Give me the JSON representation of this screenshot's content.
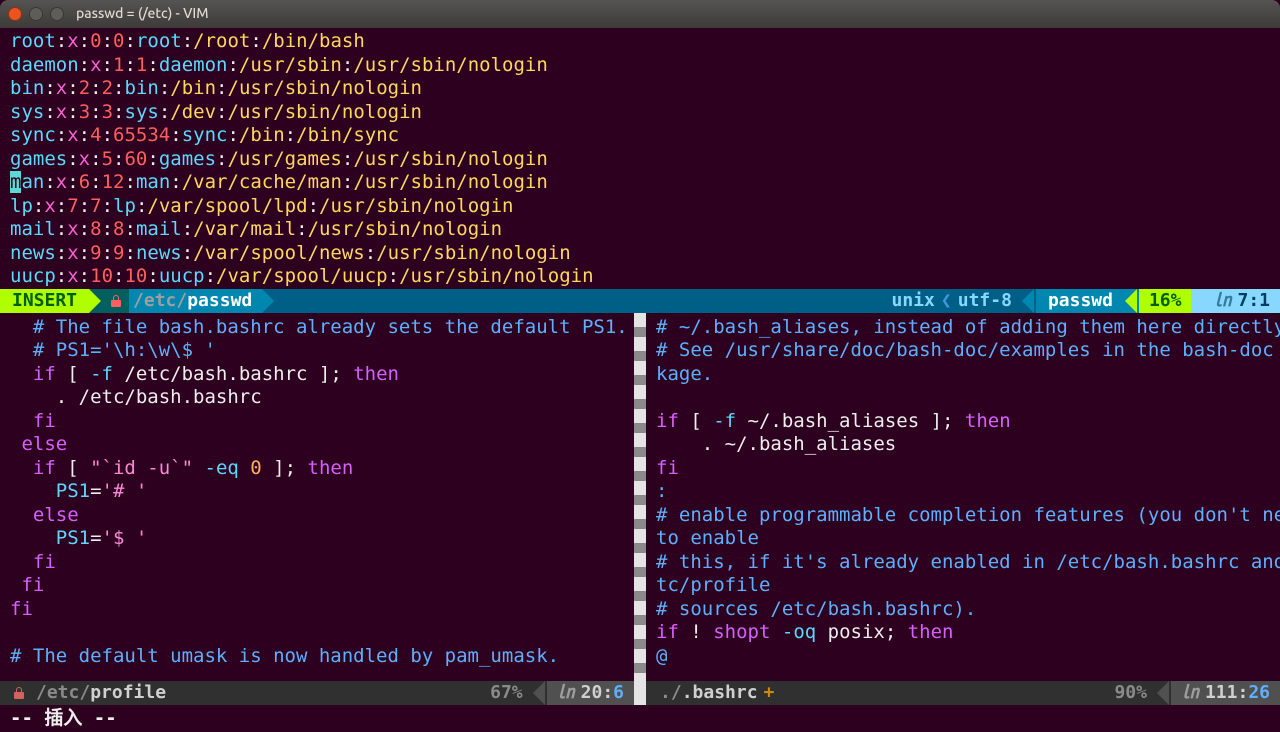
{
  "window": {
    "title": "passwd = (/etc) - VIM"
  },
  "top_status": {
    "mode": "INSERT",
    "path_dir": "/etc/",
    "path_file": "passwd",
    "encoding_left": "unix",
    "encoding_right": "utf-8",
    "filetype": "passwd",
    "percent": "16%",
    "ln_label": "㏑",
    "pos": "7:1"
  },
  "left_status": {
    "path_dir": "/etc/",
    "path_file": "profile",
    "percent": "67%",
    "ln_label": "㏑",
    "line": "20",
    "col": "6"
  },
  "right_status": {
    "path_dir": "./",
    "path_file": ".bashrc",
    "modified": "+",
    "percent": "90%",
    "ln_label": "㏑",
    "line": "111",
    "col": "26"
  },
  "cmdline": "-- 插入 --",
  "passwd": [
    {
      "user": "root",
      "x": "x",
      "uid": "0",
      "gid": "0",
      "gecos": "root",
      "home": "/root",
      "shell": "/bin/bash"
    },
    {
      "user": "daemon",
      "x": "x",
      "uid": "1",
      "gid": "1",
      "gecos": "daemon",
      "home": "/usr/sbin",
      "shell": "/usr/sbin/nologin"
    },
    {
      "user": "bin",
      "x": "x",
      "uid": "2",
      "gid": "2",
      "gecos": "bin",
      "home": "/bin",
      "shell": "/usr/sbin/nologin"
    },
    {
      "user": "sys",
      "x": "x",
      "uid": "3",
      "gid": "3",
      "gecos": "sys",
      "home": "/dev",
      "shell": "/usr/sbin/nologin"
    },
    {
      "user": "sync",
      "x": "x",
      "uid": "4",
      "gid": "65534",
      "gecos": "sync",
      "home": "/bin",
      "shell": "/bin/sync"
    },
    {
      "user": "games",
      "x": "x",
      "uid": "5",
      "gid": "60",
      "gecos": "games",
      "home": "/usr/games",
      "shell": "/usr/sbin/nologin"
    },
    {
      "user": "man",
      "x": "x",
      "uid": "6",
      "gid": "12",
      "gecos": "man",
      "home": "/var/cache/man",
      "shell": "/usr/sbin/nologin"
    },
    {
      "user": "lp",
      "x": "x",
      "uid": "7",
      "gid": "7",
      "gecos": "lp",
      "home": "/var/spool/lpd",
      "shell": "/usr/sbin/nologin"
    },
    {
      "user": "mail",
      "x": "x",
      "uid": "8",
      "gid": "8",
      "gecos": "mail",
      "home": "/var/mail",
      "shell": "/usr/sbin/nologin"
    },
    {
      "user": "news",
      "x": "x",
      "uid": "9",
      "gid": "9",
      "gecos": "news",
      "home": "/var/spool/news",
      "shell": "/usr/sbin/nologin"
    },
    {
      "user": "uucp",
      "x": "x",
      "uid": "10",
      "gid": "10",
      "gecos": "uucp",
      "home": "/var/spool/uucp",
      "shell": "/usr/sbin/nologin"
    }
  ],
  "profile_lines": [
    [
      [
        "c-comment",
        "  # The file bash.bashrc already sets the default PS1."
      ]
    ],
    [
      [
        "c-comment",
        "  # PS1='\\h:\\w\\$ '"
      ]
    ],
    [
      [
        "c-kw",
        "  if"
      ],
      [
        "c-plain",
        " [ "
      ],
      [
        "c-id",
        "-f"
      ],
      [
        "c-plain",
        " /etc/bash.bashrc ]; "
      ],
      [
        "c-kw",
        "then"
      ]
    ],
    [
      [
        "c-plain",
        "    . /etc/bash.bashrc"
      ]
    ],
    [
      [
        "c-kw",
        "  fi"
      ]
    ],
    [
      [
        "c-kw",
        " else"
      ]
    ],
    [
      [
        "c-kw",
        "  if"
      ],
      [
        "c-plain",
        " [ "
      ],
      [
        "c-str",
        "\"`id -u`\""
      ],
      [
        "c-plain",
        " "
      ],
      [
        "c-id",
        "-eq"
      ],
      [
        "c-plain",
        " "
      ],
      [
        "c-num",
        "0"
      ],
      [
        "c-plain",
        " ]; "
      ],
      [
        "c-kw",
        "then"
      ]
    ],
    [
      [
        "c-id",
        "    PS1"
      ],
      [
        "c-sym",
        "="
      ],
      [
        "c-str",
        "'# '"
      ]
    ],
    [
      [
        "c-kw",
        "  else"
      ]
    ],
    [
      [
        "c-id",
        "    PS1"
      ],
      [
        "c-sym",
        "="
      ],
      [
        "c-str",
        "'$ '"
      ]
    ],
    [
      [
        "c-kw",
        "  fi"
      ]
    ],
    [
      [
        "c-kw",
        " fi"
      ]
    ],
    [
      [
        "c-kw",
        "fi"
      ]
    ],
    [
      [
        "c-plain",
        ""
      ]
    ],
    [
      [
        "c-comment",
        "# The default umask is now handled by pam_umask."
      ]
    ]
  ],
  "bashrc_lines": [
    [
      [
        "c-comment",
        "# ~/.bash_aliases, instead of adding them here directly."
      ]
    ],
    [
      [
        "c-comment",
        "# See /usr/share/doc/bash-doc/examples in the bash-doc pac"
      ]
    ],
    [
      [
        "c-comment",
        "kage."
      ]
    ],
    [
      [
        "c-plain",
        ""
      ]
    ],
    [
      [
        "c-kw",
        "if"
      ],
      [
        "c-plain",
        " [ "
      ],
      [
        "c-id",
        "-f"
      ],
      [
        "c-plain",
        " ~/.bash_aliases ]; "
      ],
      [
        "c-kw",
        "then"
      ]
    ],
    [
      [
        "c-plain",
        "    . ~/.bash_aliases"
      ]
    ],
    [
      [
        "c-kw",
        "fi"
      ]
    ],
    [
      [
        "c-comment",
        ":"
      ]
    ],
    [
      [
        "c-comment",
        "# enable programmable completion features (you don't need "
      ]
    ],
    [
      [
        "c-comment",
        "to enable"
      ]
    ],
    [
      [
        "c-comment",
        "# this, if it's already enabled in /etc/bash.bashrc and /e"
      ]
    ],
    [
      [
        "c-comment",
        "tc/profile"
      ]
    ],
    [
      [
        "c-comment",
        "# sources /etc/bash.bashrc)."
      ]
    ],
    [
      [
        "c-kw",
        "if"
      ],
      [
        "c-plain",
        " ! "
      ],
      [
        "c-kw",
        "shopt"
      ],
      [
        "c-plain",
        " "
      ],
      [
        "c-id",
        "-oq"
      ],
      [
        "c-plain",
        " posix; "
      ],
      [
        "c-kw",
        "then"
      ]
    ],
    [
      [
        "c-comment",
        "@"
      ]
    ]
  ]
}
